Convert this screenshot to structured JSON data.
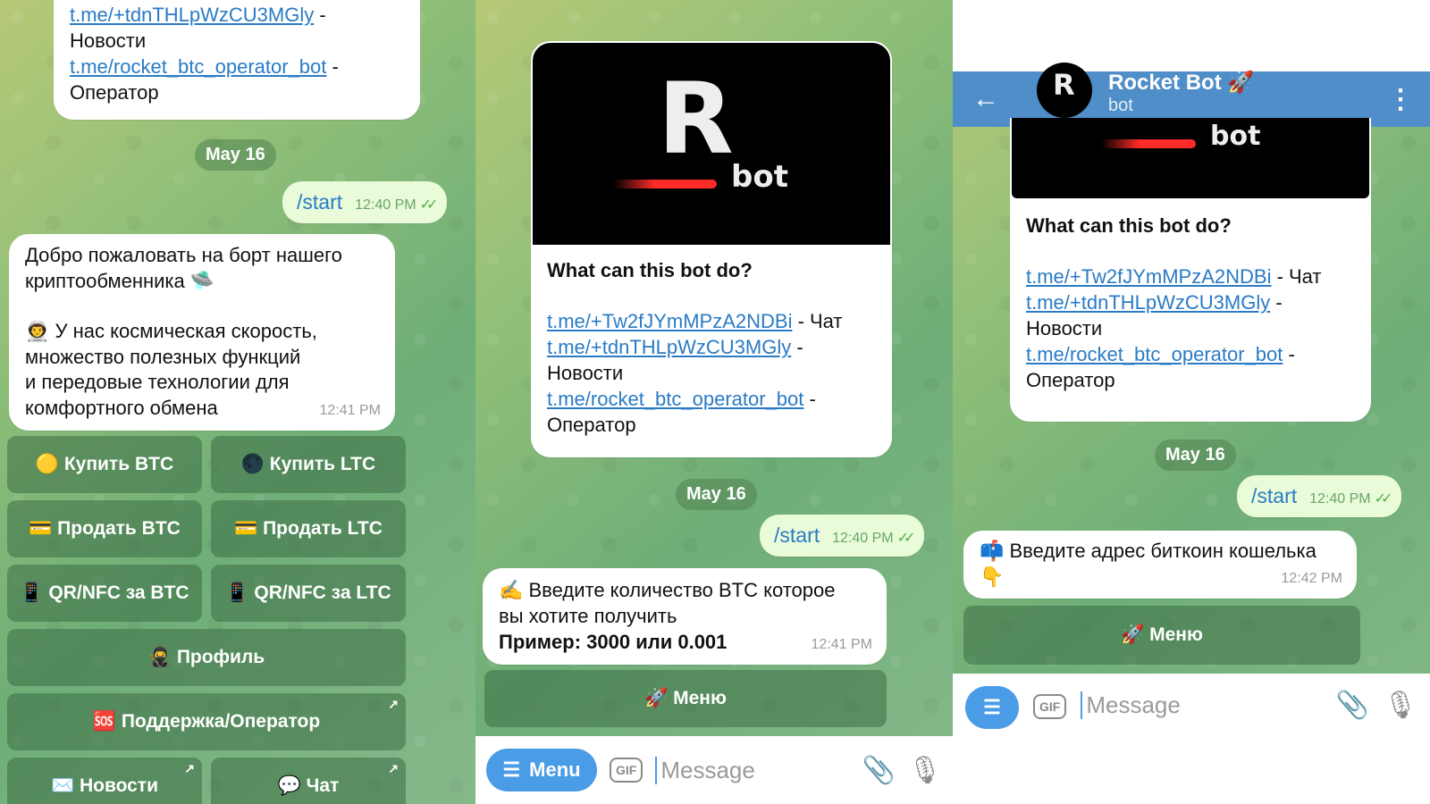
{
  "panel1": {
    "links": [
      {
        "url": "t.me/+tdnTHLpWzCU3MGly",
        "suffix": " -"
      },
      {
        "text": "Новости"
      },
      {
        "url": "t.me/rocket_btc_operator_bot",
        "suffix": " -"
      },
      {
        "text": "Оператор"
      }
    ],
    "date": "May 16",
    "start_cmd": "/start",
    "start_time": "12:40 PM",
    "welcome": {
      "line1": "Добро пожаловать на борт нашего",
      "line2": "криптообменника 🛸",
      "line3": "👨‍🚀 У нас космическая скорость,",
      "line4": "множество полезных функций",
      "line5": "и передовые технологии для",
      "line6": "комфортного обмена",
      "time": "12:41 PM"
    },
    "buttons": {
      "buy_btc": "🟡 Купить BTC",
      "buy_ltc": "🌑 Купить LTC",
      "sell_btc": "💳 Продать BTC",
      "sell_ltc": "💳 Продать LTC",
      "qr_btc": "📱 QR/NFC за BTC",
      "qr_ltc": "📱 QR/NFC за LTC",
      "profile": "🥷 Профиль",
      "support": "🆘 Поддержка/Оператор",
      "news": "✉️ Новости",
      "chat": "💬 Чат"
    }
  },
  "panel2": {
    "logo_letter": "R",
    "logo_word": "bot",
    "what_title": "What can this bot do?",
    "link_chat": "t.me/+Tw2fJYmMPzA2NDBi",
    "link_chat_suffix": " - Чат",
    "link_news": "t.me/+tdnTHLpWzCU3MGly",
    "link_news_suffix": " -",
    "news_label": "Новости",
    "link_operator": "t.me/rocket_btc_operator_bot",
    "link_operator_suffix": " -",
    "operator_label": "Оператор",
    "date": "May 16",
    "start_cmd": "/start",
    "start_time": "12:40 PM",
    "prompt_line1": "✍️ Введите количество BTC которое",
    "prompt_line2": "вы хотите получить",
    "prompt_example": "Пример: 3000 или 0.001",
    "prompt_time": "12:41 PM",
    "menu_button": "🚀 Меню",
    "input": {
      "menu_label": "Menu",
      "gif": "GIF",
      "placeholder": "Message"
    }
  },
  "panel3": {
    "header_title": "Rocket Bot 🚀",
    "header_subtitle": "bot",
    "avatar_letter": "R",
    "logo_word": "bot",
    "what_title": "What can this bot do?",
    "link_chat": "t.me/+Tw2fJYmMPzA2NDBi",
    "link_chat_suffix": " - Чат",
    "link_news": "t.me/+tdnTHLpWzCU3MGly",
    "link_news_suffix": " -",
    "news_label": "Новости",
    "link_operator": "t.me/rocket_btc_operator_bot",
    "link_operator_suffix": " -",
    "operator_label": "Оператор",
    "date": "May 16",
    "start_cmd": "/start",
    "start_time": "12:40 PM",
    "prompt_line1": "📫 Введите адрес биткоин кошелька",
    "prompt_line2": "👇",
    "prompt_time": "12:42 PM",
    "menu_button": "🚀 Меню",
    "input": {
      "gif": "GIF",
      "placeholder": "Message"
    }
  }
}
